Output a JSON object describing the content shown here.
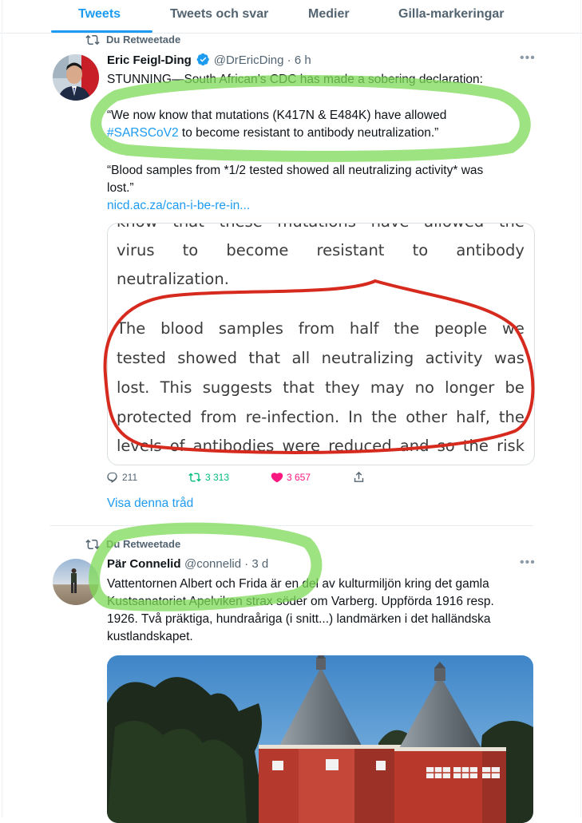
{
  "tabs": [
    {
      "label": "Tweets"
    },
    {
      "label": "Tweets och svar"
    },
    {
      "label": "Medier"
    },
    {
      "label": "Gilla-markeringar"
    }
  ],
  "tweet1": {
    "retweet_label": "Du Retweetade",
    "name": "Eric Feigl-Ding",
    "handle_time": "@DrEricDing · 6 h",
    "line1": "STUNNING—South African’s CDC has made a sobering declaration:",
    "quote_a": "“We now know that mutations (K417N & E484K) have allowed",
    "hashtag": "#SARSCoV2",
    "quote_b": " to become resistant to antibody neutralization.”",
    "blood_1": "“Blood samples from *1/2 tested showed all neutralizing activity* was",
    "blood_2": "lost.”",
    "link": "nicd.ac.za/can-i-be-re-in...",
    "card_lines": [
      [
        "know",
        "that",
        "these",
        "mutations",
        "have",
        "allowed",
        "the"
      ],
      [
        "virus",
        "to",
        "become",
        "resistant",
        "to",
        "antibody"
      ],
      [
        "neutralization."
      ],
      [
        "The",
        "blood",
        "samples",
        "from",
        "half",
        "the",
        "people",
        "we"
      ],
      [
        "tested",
        "showed",
        "that",
        "all",
        "neutralizing",
        "activity",
        "was"
      ],
      [
        "lost.",
        "This",
        "suggests",
        "that",
        "they",
        "may",
        "no",
        "longer",
        "be"
      ],
      [
        "protected",
        "from",
        "re-infection.",
        "In",
        "the",
        "other",
        "half,",
        "the"
      ],
      [
        "levels",
        "of",
        "antibodies",
        "were",
        "reduced",
        "and",
        "so",
        "the",
        "risk"
      ]
    ],
    "reply_count": "211",
    "retweet_count": "3 313",
    "like_count": "3 657",
    "thread_link": "Visa denna tråd"
  },
  "tweet2": {
    "retweet_label": "Du Retweetade",
    "name": "Pär Connelid",
    "handle_time": "@connelid · 3 d",
    "lines": [
      "Vattentornen Albert och Frida är en del av kulturmiljön kring det gamla",
      "Kustsanatoriet Apelviken strax söder om Varberg. Uppförda 1916 resp.",
      "1926. Två präktiga, hundraåriga  (i snitt...) landmärken i det halländska",
      "kustlandskapet."
    ]
  },
  "icons": {
    "retweet": "retweet-icon",
    "verified": "verified-badge-icon",
    "more": "more-options-icon",
    "reply": "reply-icon",
    "like": "heart-icon",
    "share": "share-icon"
  },
  "colors": {
    "accent": "#1d9bf0",
    "retweet_green": "#00ba7c",
    "like_pink": "#f91880",
    "highlight_green": "#7ed957",
    "highlight_red": "#d62a1e"
  }
}
